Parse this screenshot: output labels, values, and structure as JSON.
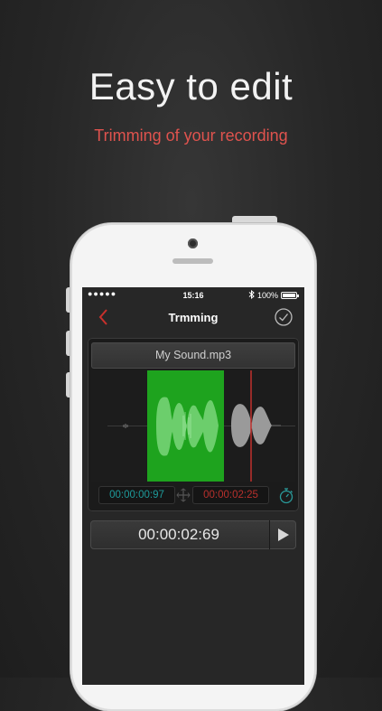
{
  "headline": "Easy to edit",
  "subheadline": "Trimming of your recording",
  "status_bar": {
    "signal": "●●●●●",
    "time": "15:16",
    "battery": "100%"
  },
  "nav": {
    "title": "Trmming",
    "back_icon": "chevron-left-icon",
    "confirm_icon": "checkmark-circle-icon"
  },
  "editor": {
    "file_name": "My Sound.mp3",
    "start_time": "00:00:00:97",
    "end_time": "00:00:02:25",
    "selection_color": "#1ea31e",
    "playhead_color": "#c0302c"
  },
  "player": {
    "duration": "00:00:02:69",
    "play_icon": "play-icon"
  },
  "colors": {
    "accent_red": "#e0534e",
    "start_teal": "#1e9a9a",
    "end_red": "#b8302c"
  }
}
